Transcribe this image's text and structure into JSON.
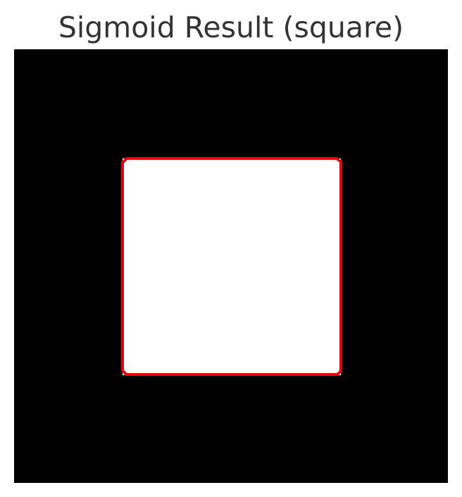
{
  "figure": {
    "title": "Sigmoid Result (square)"
  },
  "colors": {
    "background": "#000000",
    "square_fill": "#ffffff",
    "contour": "#e8000b",
    "title_text": "#333333"
  }
}
